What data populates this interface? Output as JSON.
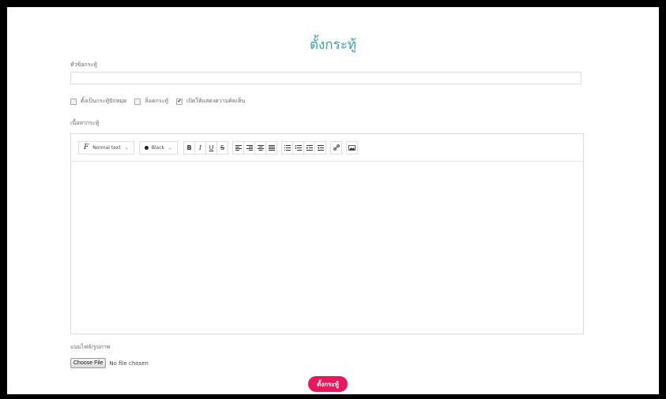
{
  "form": {
    "title": "ตั้งกระทู้",
    "subject_label": "หัวข้อกระทู้",
    "subject_value": "",
    "options": [
      {
        "label": "ตั้งเป็นกระทู้ปักหมุด",
        "checked": false
      },
      {
        "label": "ล็อคกระทู้",
        "checked": false
      },
      {
        "label": "เปิดให้แสดงความคิดเห็น",
        "checked": true
      }
    ],
    "content_label": "เนื้อหากระทู้",
    "attach_label": "แนบไฟล์/รูปภาพ",
    "choose_file": "Choose File",
    "no_file": "No file chosen",
    "submit": "ตั้งกระทู้"
  },
  "toolbar": {
    "font_style": "Normal text",
    "color": "Black",
    "bold": "B",
    "italic": "I",
    "underline": "U",
    "strike": "S"
  },
  "colors": {
    "title": "#3aa39a",
    "submit_bg": "#e8185c"
  }
}
